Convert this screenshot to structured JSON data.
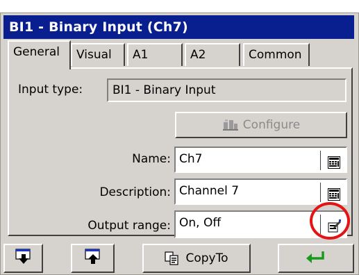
{
  "window": {
    "title": "BI1 - Binary Input (Ch7)"
  },
  "tabs": [
    {
      "label": "General"
    },
    {
      "label": "Visual"
    },
    {
      "label": "A1"
    },
    {
      "label": "A2"
    },
    {
      "label": "Common"
    }
  ],
  "general": {
    "input_type_label": "Input type:",
    "input_type_value": "BI1 - Binary Input",
    "configure_label": "Configure",
    "name_label": "Name:",
    "name_value": "Ch7",
    "description_label": "Description:",
    "description_value": "Channel 7",
    "output_range_label": "Output range:",
    "output_range_value": "On, Off"
  },
  "toolbar": {
    "copyto_label": "CopyTo"
  },
  "colors": {
    "titlebar": "#0a1f8f",
    "highlight_circle": "#e31414",
    "enter_arrow": "#1a9a1a"
  },
  "icons": {
    "configure": "config-tool-icon",
    "name_edit": "keyboard-icon",
    "description_edit": "keyboard-icon",
    "output_range_edit": "edit-list-icon",
    "import": "import-window-icon",
    "export": "export-window-icon",
    "copyto": "copy-icon",
    "enter": "enter-arrow-icon"
  }
}
